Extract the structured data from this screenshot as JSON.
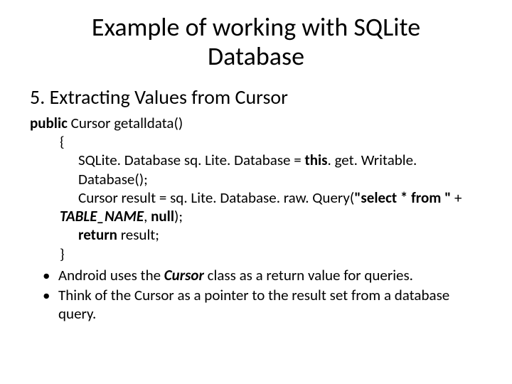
{
  "title": "Example of working with SQLite Database",
  "section": {
    "number": "5.",
    "heading": "Extracting Values from Cursor"
  },
  "code": {
    "kw_public": "public",
    "sig_rest": " Cursor getalldata()",
    "brace_open": "{",
    "line1a": "SQLite. Database sq. Lite. Database = ",
    "line1_this": "this",
    "line1b": ". get. Writable. Database();",
    "line2a": "Cursor result = sq. Lite. Database. raw. Query(",
    "line2_str": "\"select * from \"",
    "line2b": " + ",
    "line2_tbl": "TABLE_NAME",
    "line2c": ", ",
    "line2_null": "null",
    "line2d": ");",
    "line3_ret": "return ",
    "line3_rest": "result;",
    "brace_close": "}"
  },
  "bullets": [
    {
      "pre": "Android uses the ",
      "em": "Cursor",
      "post": " class as a return value for queries."
    },
    {
      "pre": "Think of the Cursor as a pointer to the result set from a database query.",
      "em": "",
      "post": ""
    }
  ]
}
